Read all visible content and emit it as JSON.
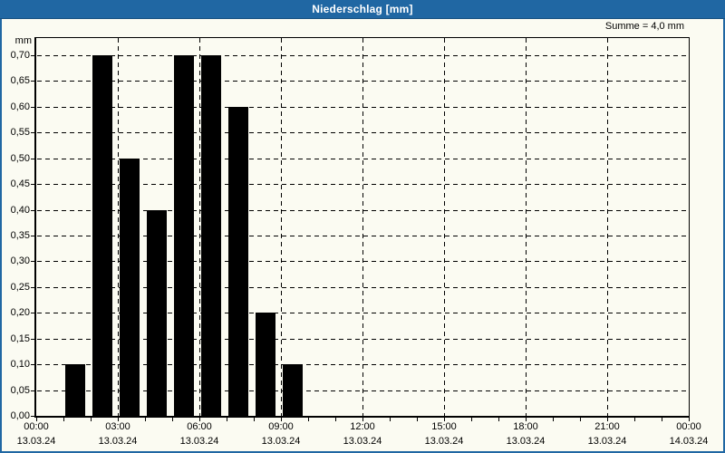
{
  "window": {
    "title": "Niederschlag [mm]"
  },
  "header": {
    "sum_label": "Summe = 4,0 mm"
  },
  "colors": {
    "accent_blue": "#2067a3",
    "titlebar_text": "#ffffff",
    "background": "#fbfbf2",
    "bar": "#000000",
    "grid": "#000000"
  },
  "chart_data": {
    "type": "bar",
    "title": "Niederschlag [mm]",
    "ylabel": "mm",
    "ylim": [
      0,
      0.735
    ],
    "ytick_step": 0.05,
    "grid": "dashed",
    "legend": null,
    "sum_mm": 4.0,
    "bar_color": "#000000",
    "yticks": [
      {
        "value": 0.0,
        "label": "0,00"
      },
      {
        "value": 0.05,
        "label": "0,05"
      },
      {
        "value": 0.1,
        "label": "0,10"
      },
      {
        "value": 0.15,
        "label": "0,15"
      },
      {
        "value": 0.2,
        "label": "0,20"
      },
      {
        "value": 0.25,
        "label": "0,25"
      },
      {
        "value": 0.3,
        "label": "0,30"
      },
      {
        "value": 0.35,
        "label": "0,35"
      },
      {
        "value": 0.4,
        "label": "0,40"
      },
      {
        "value": 0.45,
        "label": "0,45"
      },
      {
        "value": 0.5,
        "label": "0,50"
      },
      {
        "value": 0.55,
        "label": "0,55"
      },
      {
        "value": 0.6,
        "label": "0,60"
      },
      {
        "value": 0.65,
        "label": "0,65"
      },
      {
        "value": 0.7,
        "label": "0,70"
      }
    ],
    "x_axis": {
      "total_hours": 24,
      "major_tick_interval_hours": 3,
      "minor_tick_interval_hours": 1,
      "ticks": [
        {
          "hour": 0,
          "time": "00:00",
          "date": "13.03.24"
        },
        {
          "hour": 3,
          "time": "03:00",
          "date": "13.03.24"
        },
        {
          "hour": 6,
          "time": "06:00",
          "date": "13.03.24"
        },
        {
          "hour": 9,
          "time": "09:00",
          "date": "13.03.24"
        },
        {
          "hour": 12,
          "time": "12:00",
          "date": "13.03.24"
        },
        {
          "hour": 15,
          "time": "15:00",
          "date": "13.03.24"
        },
        {
          "hour": 18,
          "time": "18:00",
          "date": "13.03.24"
        },
        {
          "hour": 21,
          "time": "21:00",
          "date": "13.03.24"
        },
        {
          "hour": 24,
          "time": "00:00",
          "date": "14.03.24"
        }
      ]
    },
    "bars": [
      {
        "hour_start": 1,
        "value": 0.1
      },
      {
        "hour_start": 2,
        "value": 0.7
      },
      {
        "hour_start": 3,
        "value": 0.5
      },
      {
        "hour_start": 4,
        "value": 0.4
      },
      {
        "hour_start": 5,
        "value": 0.7
      },
      {
        "hour_start": 6,
        "value": 0.7
      },
      {
        "hour_start": 7,
        "value": 0.6
      },
      {
        "hour_start": 8,
        "value": 0.2
      },
      {
        "hour_start": 9,
        "value": 0.1
      }
    ]
  }
}
